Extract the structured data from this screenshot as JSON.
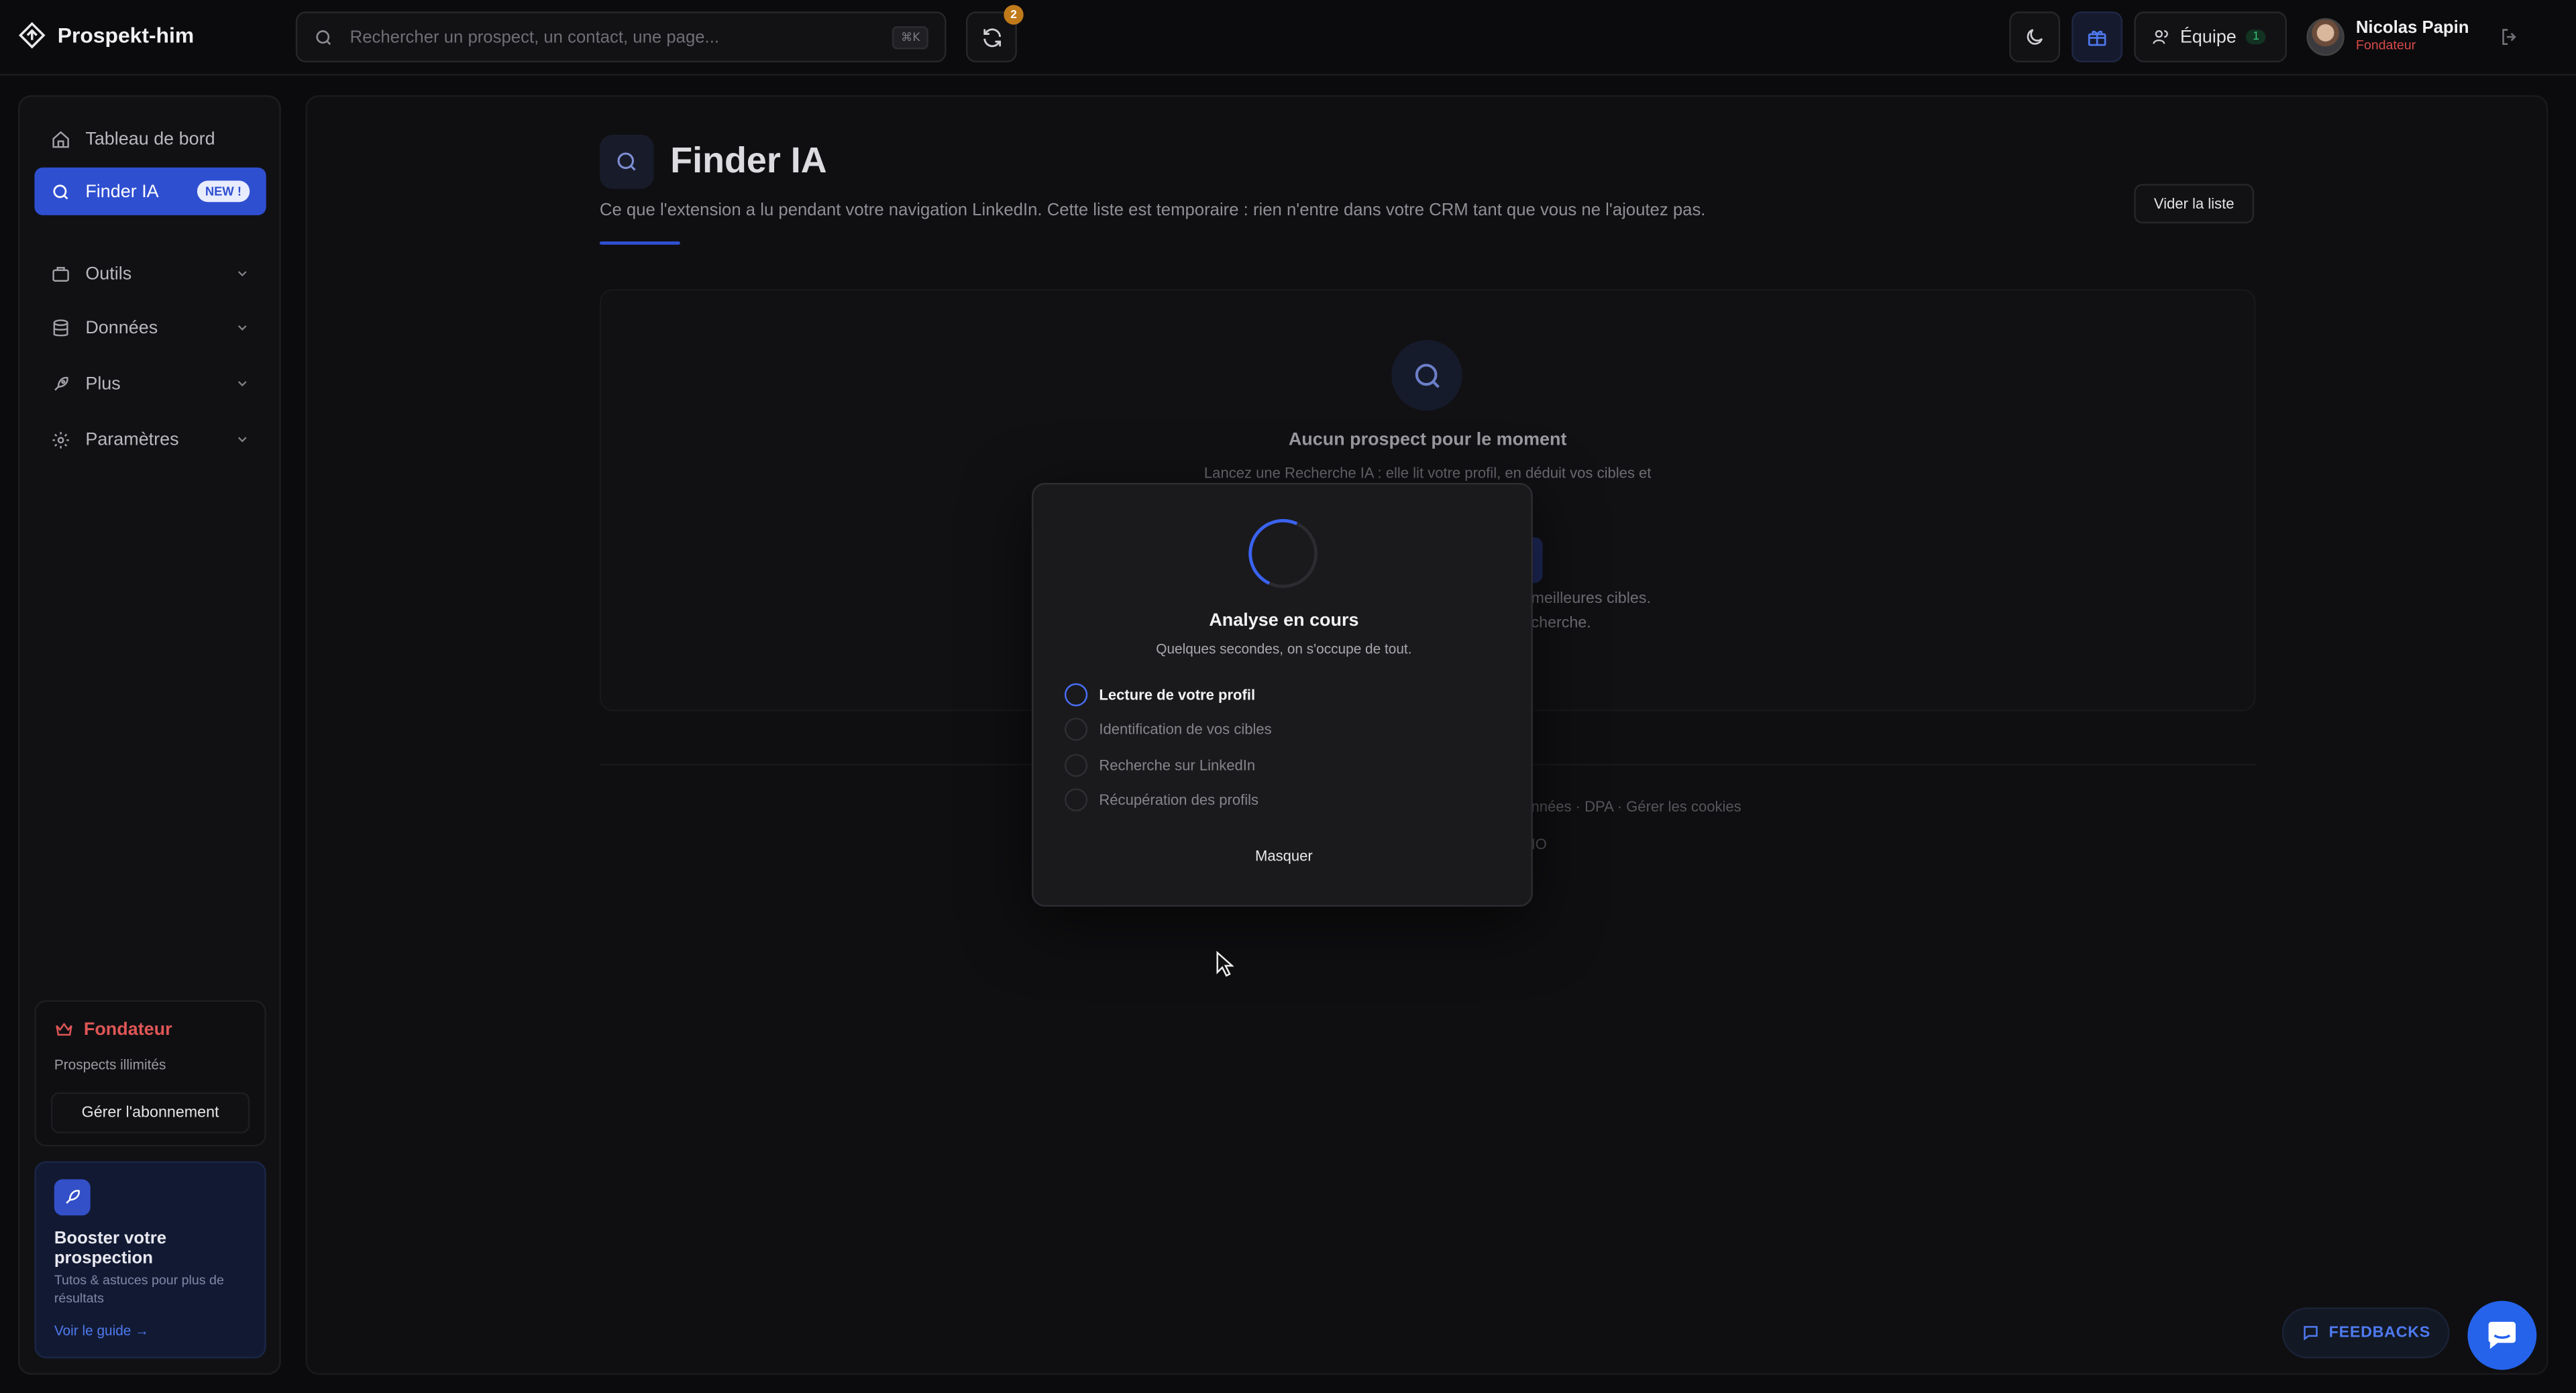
{
  "app": {
    "name": "Prospekt-him"
  },
  "search": {
    "placeholder": "Rechercher un prospect, un contact, une page...",
    "shortcut": "⌘K"
  },
  "header": {
    "sync_count": "2",
    "team_label": "Équipe",
    "team_count": "1",
    "user_name": "Nicolas Papin",
    "user_role": "Fondateur"
  },
  "sidebar": {
    "items": [
      {
        "label": "Tableau de bord"
      },
      {
        "label": "Finder IA",
        "badge": "NEW !"
      },
      {
        "label": "Outils"
      },
      {
        "label": "Données"
      },
      {
        "label": "Plus"
      },
      {
        "label": "Paramètres"
      }
    ],
    "plan": {
      "name": "Fondateur",
      "sub": "Prospects illimités",
      "button": "Gérer l'abonnement"
    },
    "guide": {
      "title": "Booster votre prospection",
      "sub": "Tutos & astuces pour plus de résultats",
      "link": "Voir le guide →"
    }
  },
  "main": {
    "title": "Finder IA",
    "description": "Ce que l'extension a lu pendant votre navigation LinkedIn. Cette liste est temporaire : rien n'entre dans votre CRM tant que vous ne l'ajoutez pas.",
    "clear_button": "Vider la liste",
    "empty": {
      "title": "Aucun prospect pour le moment",
      "desc": "Lancez une Recherche IA : elle lit votre profil, en déduit vos cibles et",
      "note1": "meilleures cibles.",
      "note2": "cherche."
    },
    "footer": {
      "links": "nnées · DPA · Gérer les cookies",
      "studio": "IO"
    }
  },
  "modal": {
    "title": "Analyse en cours",
    "subtitle": "Quelques secondes, on s'occupe de tout.",
    "steps": [
      {
        "label": "Lecture de votre profil",
        "state": "active"
      },
      {
        "label": "Identification de vos cibles",
        "state": "pending"
      },
      {
        "label": "Recherche sur LinkedIn",
        "state": "pending"
      },
      {
        "label": "Récupération des profils",
        "state": "pending"
      }
    ],
    "hide_button": "Masquer"
  },
  "feedback": {
    "label": "FEEDBACKS"
  },
  "colors": {
    "accent": "#2f4fd1",
    "danger": "#e05656",
    "background": "#0b0b0d"
  }
}
